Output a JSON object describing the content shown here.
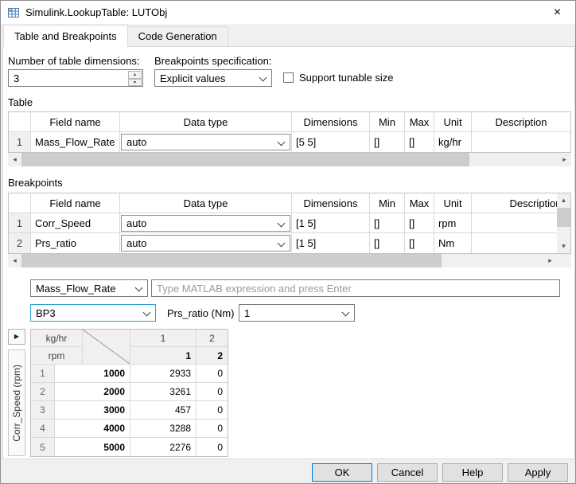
{
  "window": {
    "title": "Simulink.LookupTable: LUTObj"
  },
  "icons": {
    "close": "×",
    "spinner_up": "▴",
    "spinner_down": "▾",
    "scroll_left": "◂",
    "scroll_right": "▸",
    "scroll_up": "▴",
    "scroll_down": "▾",
    "expand": "▶"
  },
  "tabs": [
    {
      "label": "Table and Breakpoints"
    },
    {
      "label": "Code Generation"
    }
  ],
  "form": {
    "dimensions_label": "Number of table dimensions:",
    "dimensions_value": "3",
    "breakpoints_spec_label": "Breakpoints specification:",
    "breakpoints_spec_value": "Explicit values",
    "tunable_size_label": "Support tunable size"
  },
  "table_section": {
    "title": "Table",
    "headers": {
      "field": "Field name",
      "data_type": "Data type",
      "dimensions": "Dimensions",
      "min": "Min",
      "max": "Max",
      "unit": "Unit",
      "description": "Description"
    },
    "rows": [
      {
        "index": "1",
        "field": "Mass_Flow_Rate",
        "data_type": "auto",
        "dimensions": "[5 5]",
        "min": "[]",
        "max": "[]",
        "unit": "kg/hr",
        "description": ""
      }
    ]
  },
  "breakpoints_section": {
    "title": "Breakpoints",
    "headers": {
      "field": "Field name",
      "data_type": "Data type",
      "dimensions": "Dimensions",
      "min": "Min",
      "max": "Max",
      "unit": "Unit",
      "description": "Description"
    },
    "rows": [
      {
        "index": "1",
        "field": "Corr_Speed",
        "data_type": "auto",
        "dimensions": "[1 5]",
        "min": "[]",
        "max": "[]",
        "unit": "rpm",
        "description": ""
      },
      {
        "index": "2",
        "field": "Prs_ratio",
        "data_type": "auto",
        "dimensions": "[1 5]",
        "min": "[]",
        "max": "[]",
        "unit": "Nm",
        "description": ""
      }
    ]
  },
  "editor": {
    "field_selector_value": "Mass_Flow_Rate",
    "expression_placeholder": "Type MATLAB expression and press Enter",
    "breakpoint_selector_value": "BP3",
    "page_dimension_label": "Prs_ratio (Nm)",
    "page_dimension_value": "1"
  },
  "grid": {
    "row_axis_label": "Corr_Speed (rpm)",
    "corner_top_unit": "kg/hr",
    "corner_bottom_unit": "rpm",
    "column_indices": [
      "1",
      "2"
    ],
    "column_breakpoints": [
      "1",
      "2"
    ],
    "rows": [
      {
        "index": "1",
        "breakpoint": "1000",
        "values": [
          "2933",
          "0"
        ]
      },
      {
        "index": "2",
        "breakpoint": "2000",
        "values": [
          "3261",
          "0"
        ]
      },
      {
        "index": "3",
        "breakpoint": "3000",
        "values": [
          "457",
          "0"
        ]
      },
      {
        "index": "4",
        "breakpoint": "4000",
        "values": [
          "3288",
          "0"
        ]
      },
      {
        "index": "5",
        "breakpoint": "5000",
        "values": [
          "2276",
          "0"
        ]
      }
    ]
  },
  "buttons": {
    "ok": "OK",
    "cancel": "Cancel",
    "help": "Help",
    "apply": "Apply"
  },
  "colors": {
    "focus_border": "#2a9fd8",
    "default_button_border": "#0078d7",
    "accent": "#0078d7"
  }
}
